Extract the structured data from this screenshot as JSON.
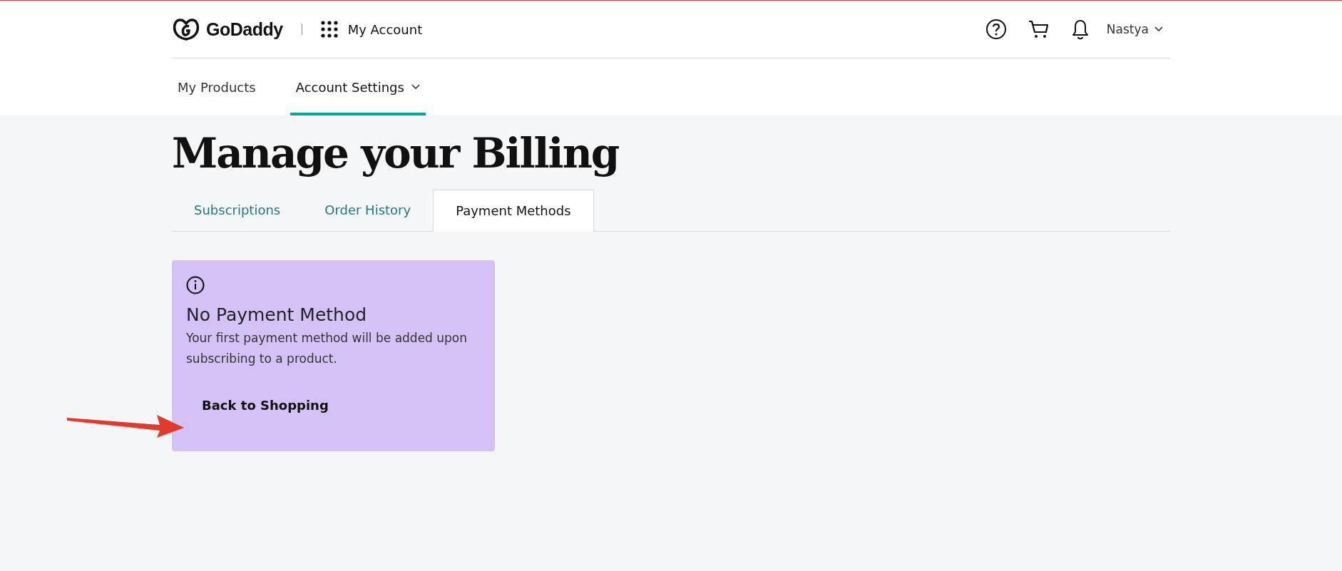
{
  "header": {
    "brand": "GoDaddy",
    "app_name": "My Account",
    "user": "Nastya"
  },
  "nav": [
    {
      "label": "My Products",
      "selected": false,
      "dropdown": false
    },
    {
      "label": "Account Settings",
      "selected": true,
      "dropdown": true
    }
  ],
  "title": "Manage your Billing",
  "tabs": [
    {
      "label": "Subscriptions",
      "selected": false
    },
    {
      "label": "Order History",
      "selected": false
    },
    {
      "label": "Payment Methods",
      "selected": true
    }
  ],
  "notice": {
    "title": "No Payment Method",
    "message": "Your first payment method will be added upon subscribing to a product.",
    "button": "Back to Shopping"
  }
}
